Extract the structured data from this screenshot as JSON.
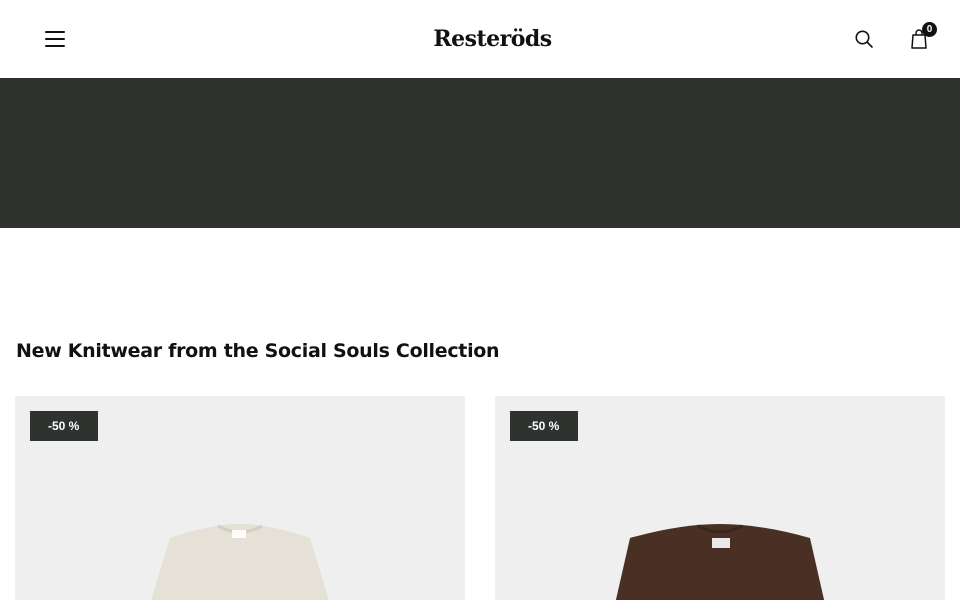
{
  "header": {
    "logo_text": "Resteröds",
    "menu_icon": "hamburger-menu-icon",
    "search_icon": "search-icon",
    "cart_icon": "shopping-bag-icon",
    "cart_count": "0"
  },
  "hero": {
    "background_color": "#2e3330"
  },
  "section": {
    "title": "New Knitwear from the Social Souls Collection"
  },
  "products": [
    {
      "badge": "-50 %",
      "sweater_color": "#e6e1d6"
    },
    {
      "badge": "-50 %",
      "sweater_color": "#4a3024"
    }
  ]
}
